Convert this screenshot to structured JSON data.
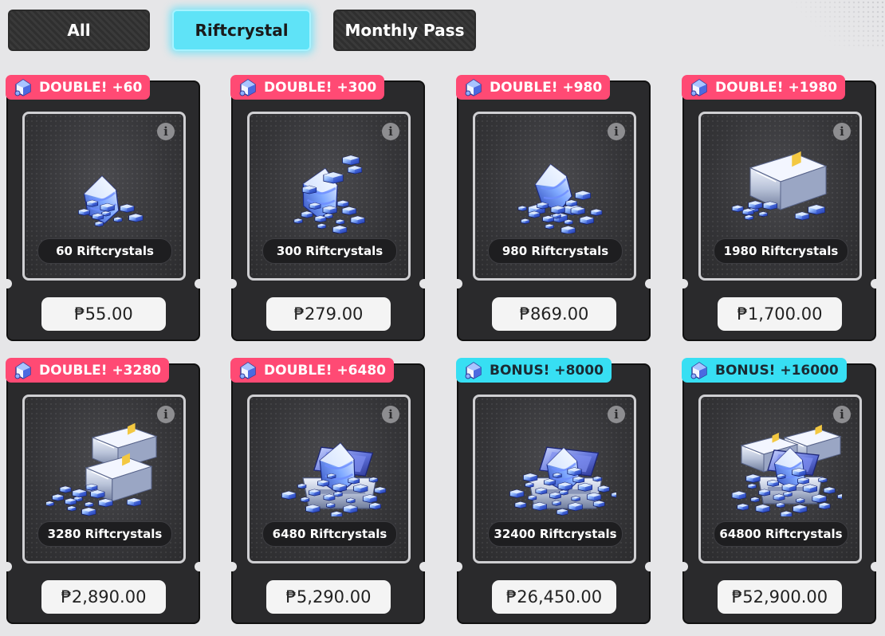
{
  "tabs": [
    {
      "label": "All",
      "active": false
    },
    {
      "label": "Riftcrystal",
      "active": true
    },
    {
      "label": "Monthly Pass",
      "active": false
    }
  ],
  "colors": {
    "double_badge": "#ff4a74",
    "bonus_badge": "#37dff3",
    "active_tab": "#5fe3f7",
    "card_bg": "#2a2a2c",
    "page_bg": "#e6e6e8"
  },
  "products": [
    {
      "badge": "DOUBLE! +60",
      "badge_type": "double",
      "amount": "60 Riftcrystals",
      "price": "₱55.00",
      "art_icon": "crystal-pile-icon"
    },
    {
      "badge": "DOUBLE! +300",
      "badge_type": "double",
      "amount": "300 Riftcrystals",
      "price": "₱279.00",
      "art_icon": "crystal-pile-icon"
    },
    {
      "badge": "DOUBLE! +980",
      "badge_type": "double",
      "amount": "980 Riftcrystals",
      "price": "₱869.00",
      "art_icon": "crystal-pile-icon"
    },
    {
      "badge": "DOUBLE! +1980",
      "badge_type": "double",
      "amount": "1980 Riftcrystals",
      "price": "₱1,700.00",
      "art_icon": "crystal-case-icon"
    },
    {
      "badge": "DOUBLE! +3280",
      "badge_type": "double",
      "amount": "3280 Riftcrystals",
      "price": "₱2,890.00",
      "art_icon": "crystal-case-stack-icon"
    },
    {
      "badge": "DOUBLE! +6480",
      "badge_type": "double",
      "amount": "6480 Riftcrystals",
      "price": "₱5,290.00",
      "art_icon": "open-crystal-chest-icon"
    },
    {
      "badge": "BONUS! +8000",
      "badge_type": "bonus",
      "amount": "32400 Riftcrystals",
      "price": "₱26,450.00",
      "art_icon": "open-crystal-chest-icon"
    },
    {
      "badge": "BONUS! +16000",
      "badge_type": "bonus",
      "amount": "64800 Riftcrystals",
      "price": "₱52,900.00",
      "art_icon": "crystal-chest-stack-icon"
    }
  ],
  "icons": {
    "badge": "riftcrystal-icon",
    "info": "info-icon",
    "info_glyph": "i"
  }
}
